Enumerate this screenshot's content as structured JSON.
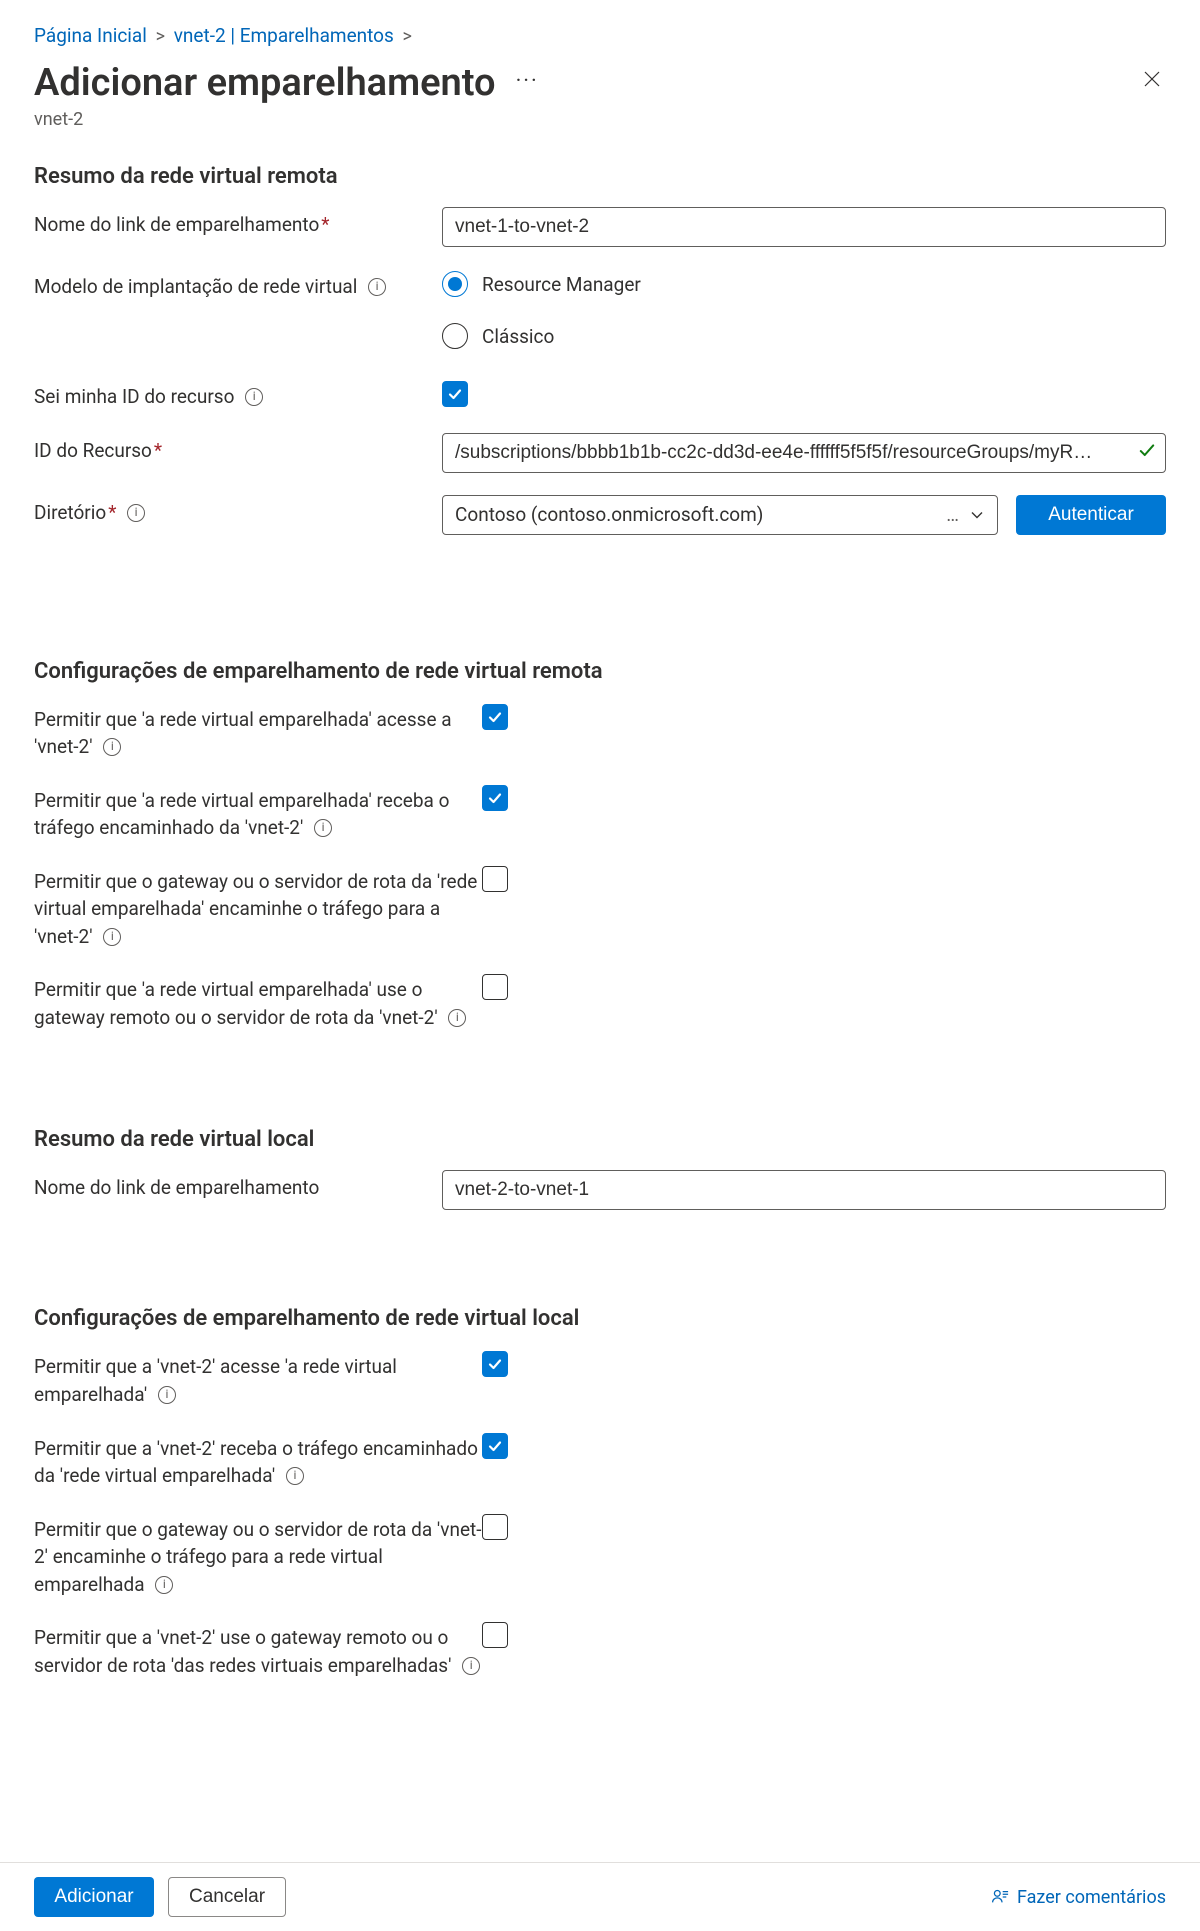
{
  "breadcrumb": {
    "items": [
      {
        "label": "Página Inicial"
      },
      {
        "label": "vnet-2 | Emparelhamentos"
      }
    ]
  },
  "header": {
    "title": "Adicionar emparelhamento",
    "subtitle": "vnet-2"
  },
  "sections": {
    "remoteSummary": {
      "title": "Resumo da rede virtual remota",
      "peeringLinkName": {
        "label": "Nome do link de emparelhamento",
        "required": true,
        "value": "vnet-1-to-vnet-2"
      },
      "deploymentModel": {
        "label": "Modelo de implantação de rede virtual",
        "options": [
          {
            "label": "Resource Manager",
            "selected": true
          },
          {
            "label": "Clássico",
            "selected": false
          }
        ]
      },
      "knowResourceId": {
        "label": "Sei minha ID do recurso",
        "checked": true
      },
      "resourceId": {
        "label": "ID do Recurso",
        "required": true,
        "value": "/subscriptions/bbbb1b1b-cc2c-dd3d-ee4e-ffffff5f5f5f/resourceGroups/myR…",
        "validated": true
      },
      "directory": {
        "label": "Diretório",
        "required": true,
        "value": "Contoso (contoso.onmicrosoft.com)",
        "ellipsis": "…",
        "authButton": "Autenticar"
      }
    },
    "remoteSettings": {
      "title": "Configurações de emparelhamento de rede virtual remota",
      "items": [
        {
          "label": "Permitir que 'a rede virtual emparelhada' acesse a 'vnet-2'",
          "checked": true
        },
        {
          "label": "Permitir que 'a rede virtual emparelhada' receba o tráfego encaminhado da 'vnet-2'",
          "checked": true
        },
        {
          "label": "Permitir que o gateway ou o servidor de rota da 'rede virtual emparelhada' encaminhe o tráfego para a 'vnet-2'",
          "checked": false
        },
        {
          "label": "Permitir que 'a rede virtual emparelhada' use o gateway remoto ou o servidor de rota da 'vnet-2'",
          "checked": false
        }
      ]
    },
    "localSummary": {
      "title": "Resumo da rede virtual local",
      "peeringLinkName": {
        "label": "Nome do link de emparelhamento",
        "value": "vnet-2-to-vnet-1"
      }
    },
    "localSettings": {
      "title": "Configurações de emparelhamento de rede virtual local",
      "items": [
        {
          "label": "Permitir que a 'vnet-2' acesse 'a rede virtual emparelhada'",
          "checked": true
        },
        {
          "label": "Permitir que a 'vnet-2' receba o tráfego encaminhado da 'rede virtual emparelhada'",
          "checked": true
        },
        {
          "label": "Permitir que o gateway ou o servidor de rota da 'vnet-2' encaminhe o tráfego para a rede virtual emparelhada",
          "checked": false
        },
        {
          "label": "Permitir que a 'vnet-2' use o gateway remoto ou o servidor de rota 'das redes virtuais emparelhadas'",
          "checked": false
        }
      ]
    }
  },
  "footer": {
    "addButton": "Adicionar",
    "cancelButton": "Cancelar",
    "feedback": "Fazer comentários"
  }
}
